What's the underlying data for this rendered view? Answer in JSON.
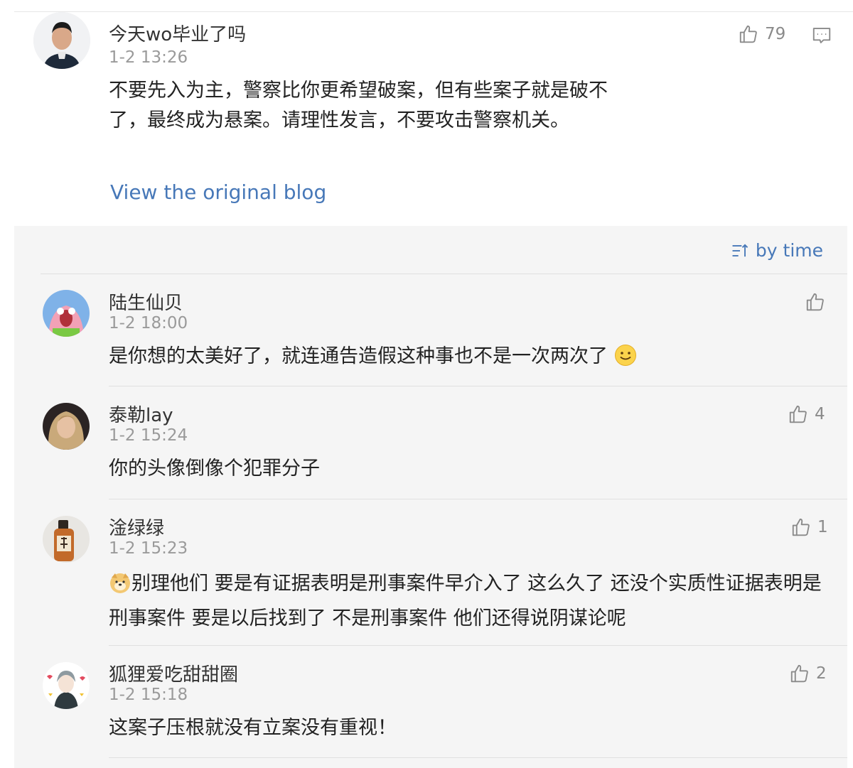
{
  "main": {
    "author": "今天wo毕业了吗",
    "time": "1-2 13:26",
    "text": "不要先入为主，警察比你更希望破案，但有些案子就是破不了，最终成为悬案。请理性发言，不要攻击警察机关。",
    "likes": "79",
    "view_link": "View the original blog"
  },
  "sort_label": "by time",
  "replies": [
    {
      "name": "陆生仙贝",
      "time": "1-2 18:00",
      "text": "是你想的太美好了，就连通告造假这种事也不是一次两次了",
      "likes": ""
    },
    {
      "name": "泰勒lay",
      "time": "1-2 15:24",
      "text": "你的头像倒像个犯罪分子",
      "likes": "4"
    },
    {
      "name": "淦绿绿",
      "time": "1-2 15:23",
      "text": "别理他们 要是有证据表明是刑事案件早介入了 这么久了 还没个实质性证据表明是刑事案件 要是以后找到了 不是刑事案件 他们还得说阴谋论呢",
      "likes": "1"
    },
    {
      "name": "狐狸爱吃甜甜圈",
      "time": "1-2 15:18",
      "text": "这案子压根就没有立案没有重视！",
      "likes": "2"
    }
  ],
  "colors": {
    "link": "#4778b8",
    "panel": "#f5f5f5",
    "muted": "#9a9a9a"
  },
  "icons": [
    "thumbs-up-icon",
    "comment-icon",
    "sort-icon",
    "smile-emoji",
    "doge-emoji"
  ]
}
